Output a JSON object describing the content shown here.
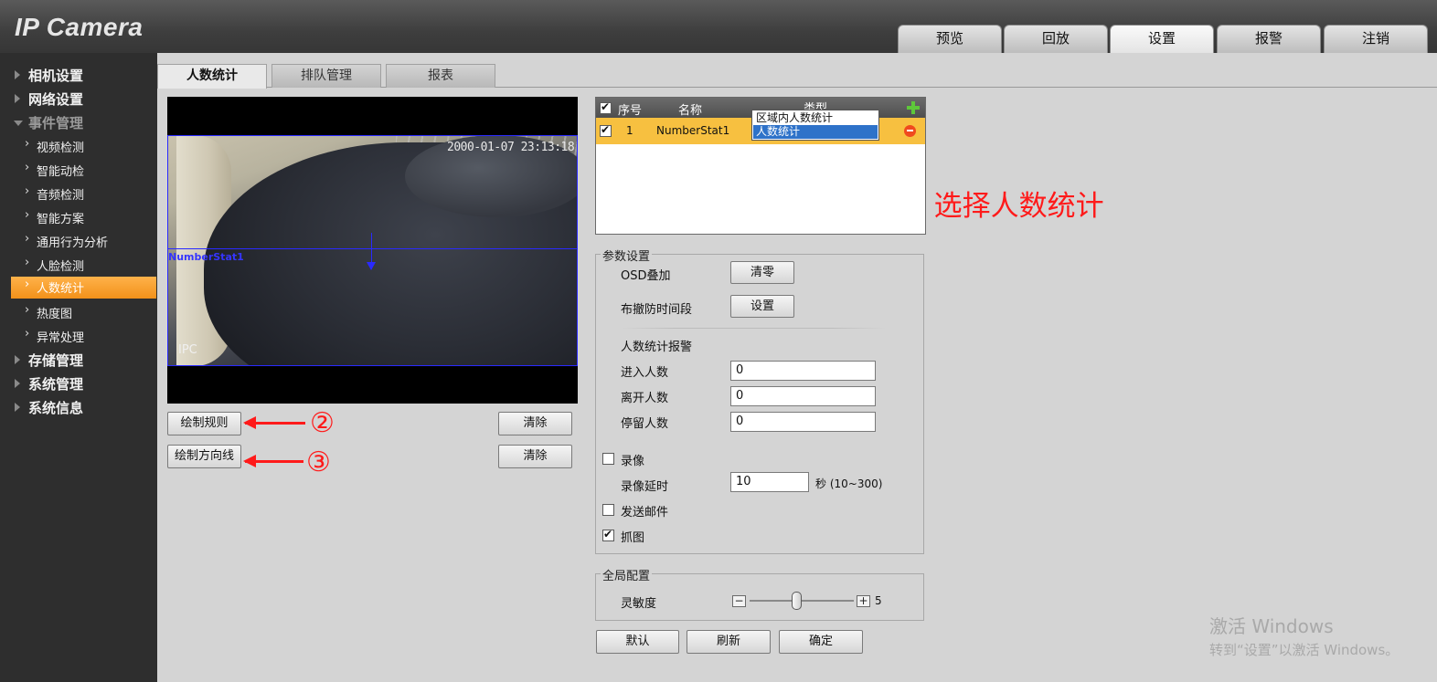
{
  "app": {
    "logo": "IP Camera"
  },
  "main_nav": [
    "预览",
    "回放",
    "设置",
    "报警",
    "注销"
  ],
  "main_nav_active": "设置",
  "sidebar": {
    "items": [
      {
        "label": "相机设置",
        "level": 1,
        "icon": "triangle-right-icon"
      },
      {
        "label": "网络设置",
        "level": 1,
        "icon": "triangle-right-icon"
      },
      {
        "label": "事件管理",
        "level": 1,
        "icon": "triangle-down-icon",
        "expanded": true
      },
      {
        "label": "视频检测",
        "level": 2,
        "icon": "chevron-right-icon"
      },
      {
        "label": "智能动检",
        "level": 2,
        "icon": "chevron-right-icon"
      },
      {
        "label": "音频检测",
        "level": 2,
        "icon": "chevron-right-icon"
      },
      {
        "label": "智能方案",
        "level": 2,
        "icon": "chevron-right-icon"
      },
      {
        "label": "通用行为分析",
        "level": 2,
        "icon": "chevron-right-icon"
      },
      {
        "label": "人脸检测",
        "level": 2,
        "icon": "chevron-right-icon"
      },
      {
        "label": "人数统计",
        "level": 2,
        "icon": "chevron-right-icon",
        "active": true
      },
      {
        "label": "热度图",
        "level": 2,
        "icon": "chevron-right-icon"
      },
      {
        "label": "异常处理",
        "level": 2,
        "icon": "chevron-right-icon"
      },
      {
        "label": "存储管理",
        "level": 1,
        "icon": "triangle-right-icon"
      },
      {
        "label": "系统管理",
        "level": 1,
        "icon": "triangle-right-icon"
      },
      {
        "label": "系统信息",
        "level": 1,
        "icon": "triangle-right-icon"
      }
    ]
  },
  "sub_tabs": [
    "人数统计",
    "排队管理",
    "报表"
  ],
  "sub_tab_active": "人数统计",
  "video": {
    "osd_time": "2000-01-07 23:13:18",
    "osd_channel": "IPC",
    "rule_label": "NumberStat1"
  },
  "video_buttons": {
    "draw_rule": "绘制规则",
    "clear_rule": "清除",
    "draw_direction": "绘制方向线",
    "clear_direction": "清除"
  },
  "rule_table": {
    "headers": {
      "index": "序号",
      "name": "名称",
      "type": "类型"
    },
    "rows": [
      {
        "checked": true,
        "index": "1",
        "name": "NumberStat1",
        "type": "人数统计"
      }
    ],
    "type_options": [
      "区域内人数统计",
      "人数统计"
    ],
    "type_selected": "人数统计"
  },
  "params": {
    "legend": "参数设置",
    "osd_label": "OSD叠加",
    "osd_button": "清零",
    "schedule_label": "布撤防时间段",
    "schedule_button": "设置",
    "alarm_title": "人数统计报警",
    "enter_label": "进入人数",
    "enter_value": "0",
    "leave_label": "离开人数",
    "leave_value": "0",
    "stay_label": "停留人数",
    "stay_value": "0",
    "record_label": "录像",
    "record_checked": false,
    "record_delay_label": "录像延时",
    "record_delay_value": "10",
    "record_delay_unit": "秒 (10~300)",
    "email_label": "发送邮件",
    "email_checked": false,
    "snapshot_label": "抓图",
    "snapshot_checked": true
  },
  "global_config": {
    "legend": "全局配置",
    "sensitivity_label": "灵敏度",
    "sensitivity_value": "5",
    "minus": "−",
    "plus": "+"
  },
  "footer_buttons": {
    "default": "默认",
    "refresh": "刷新",
    "confirm": "确定"
  },
  "annotations": {
    "step1": "① 选择人数统计",
    "step2": "②",
    "step3": "③"
  },
  "watermark": {
    "line1": "激活 Windows",
    "line2": "转到“设置”以激活 Windows。"
  },
  "colors": {
    "accent_orange": "#f2911a",
    "annotation_red": "#ff1a1a",
    "selected_row": "#f7c040",
    "rule_blue": "#2a2aff",
    "dropdown_selected": "#2e72c9"
  }
}
